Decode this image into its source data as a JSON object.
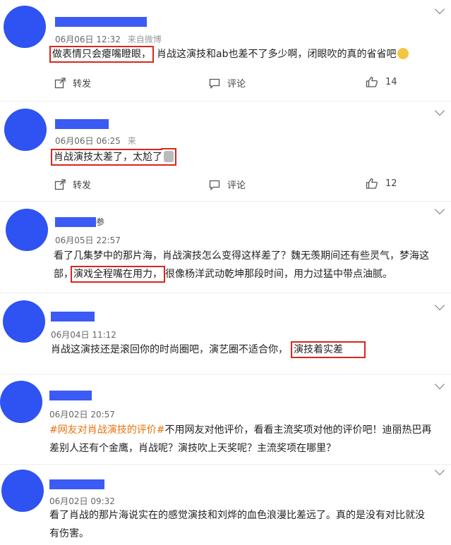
{
  "comments": [
    {
      "date": "06月06日 12:32",
      "source": "来自微博",
      "text_highlight": "做表情只会瘪嘴瞪眼，",
      "text_rest": "肖战这演技和ab也差不了多少啊，闭眼吹的真的省省吧",
      "actions": {
        "repost": "转发",
        "comment": "评论",
        "like_count": "14"
      }
    },
    {
      "date": "06月06日 06:25",
      "source": "来",
      "text_highlight": "肖战演技太差了，太尬了",
      "actions": {
        "repost": "转发",
        "comment": "评论",
        "like_count": "12"
      }
    },
    {
      "name_suffix": "参",
      "date": "06月05日 22:57",
      "line1": "看了几集梦中的那片海，肖战演技怎么变得这样差了？魏无羡期间还有些灵气，梦海这",
      "line2_pre": "部，",
      "text_highlight": "演戏全程嘴在用力，",
      "line2_post": "很像杨洋武动乾坤那段时间，用力过猛中带点油腻。"
    },
    {
      "date": "06月04日 11:12",
      "text_pre": "肖战这演技还是滚回你的时尚圈吧，演艺圈不适合你，",
      "text_highlight": "演技着实差"
    },
    {
      "date": "06月02日 20:57",
      "hashtag": "#网友对肖战演技的评价#",
      "line1_rest": "不用网友对他评价，看看主流奖项对他的评价吧！迪丽热巴再",
      "line2": "差别人还有个金鹰，肖战呢？演技吹上天奖呢？主流奖项在哪里？"
    },
    {
      "date": "06月02日 09:32",
      "line1": "看了肖战的那片海说实在的感觉演技和刘烨的血色浪漫比差远了。真的是没有对比就没",
      "line2": "有伤害。"
    }
  ]
}
